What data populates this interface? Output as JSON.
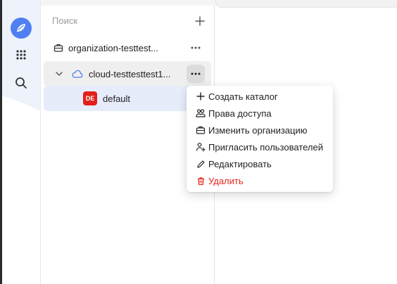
{
  "colors": {
    "accent": "#4f7ff0",
    "selected_row_bg": "#e7ecfb",
    "hover_row_bg": "#efefef",
    "danger": "#e8231a",
    "badge_bg": "#e1201a"
  },
  "rail": {
    "items": [
      {
        "icon": "logo-icon"
      },
      {
        "icon": "apps-grid-icon"
      },
      {
        "icon": "search-icon"
      }
    ]
  },
  "tree": {
    "search_placeholder": "Поиск",
    "add_icon": "plus-icon",
    "organization": {
      "label": "organization-testtest...",
      "icon": "briefcase-icon"
    },
    "cloud": {
      "label": "cloud-testtesttest1...",
      "icon": "cloud-icon",
      "expander_icon": "chevron-down-icon"
    },
    "folder": {
      "label": "default",
      "badge": "DE"
    }
  },
  "context_menu": {
    "items": [
      {
        "label": "Создать каталог",
        "icon": "plus-icon",
        "danger": false
      },
      {
        "label": "Права доступа",
        "icon": "people-icon",
        "danger": false
      },
      {
        "label": "Изменить организацию",
        "icon": "briefcase-icon",
        "danger": false
      },
      {
        "label": "Пригласить пользователей",
        "icon": "add-user-icon",
        "danger": false
      },
      {
        "label": "Редактировать",
        "icon": "pencil-icon",
        "danger": false
      },
      {
        "label": "Удалить",
        "icon": "trash-icon",
        "danger": true
      }
    ]
  }
}
